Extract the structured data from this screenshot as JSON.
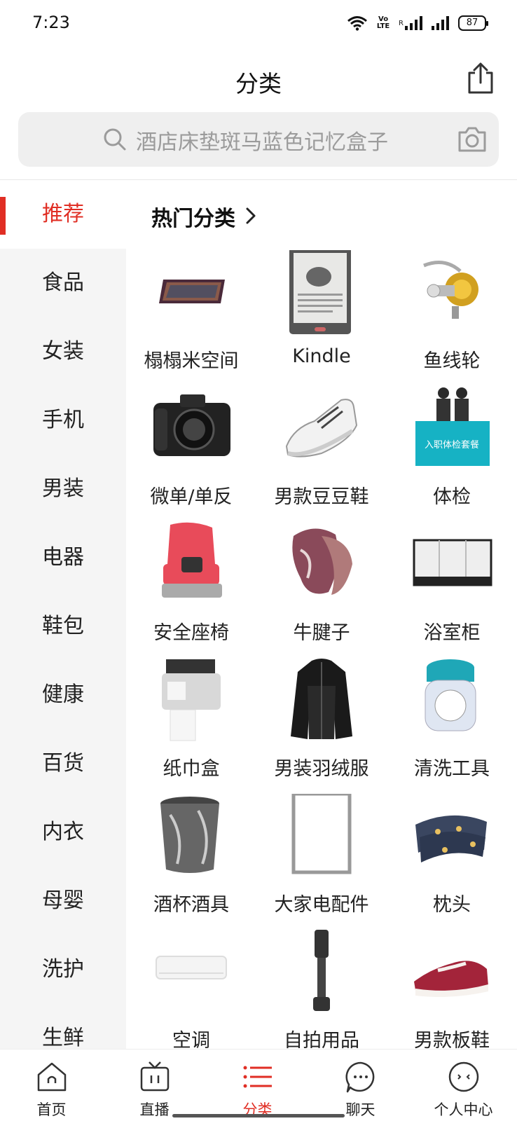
{
  "status": {
    "time": "7:23",
    "battery": "87",
    "volte_top": "Vo",
    "volte_bottom": "LTE",
    "sim_label": "R"
  },
  "header": {
    "title": "分类"
  },
  "search": {
    "placeholder": "酒店床垫斑马蓝色记忆盒子"
  },
  "sidebar": {
    "items": [
      {
        "label": "推荐",
        "active": true
      },
      {
        "label": "食品"
      },
      {
        "label": "女装"
      },
      {
        "label": "手机"
      },
      {
        "label": "男装"
      },
      {
        "label": "电器"
      },
      {
        "label": "鞋包"
      },
      {
        "label": "健康"
      },
      {
        "label": "百货"
      },
      {
        "label": "内衣"
      },
      {
        "label": "母婴"
      },
      {
        "label": "洗护"
      },
      {
        "label": "生鲜"
      }
    ]
  },
  "content": {
    "section_title": "热门分类",
    "categories": [
      {
        "label": "榻榻米空间",
        "icon": "tatami-rug-image"
      },
      {
        "label": "Kindle",
        "icon": "ereader-image"
      },
      {
        "label": "鱼线轮",
        "icon": "fishing-reel-image"
      },
      {
        "label": "微单/单反",
        "icon": "camera-image"
      },
      {
        "label": "男款豆豆鞋",
        "icon": "sneaker-image"
      },
      {
        "label": "体检",
        "icon": "health-checkup-image"
      },
      {
        "label": "安全座椅",
        "icon": "child-seat-image"
      },
      {
        "label": "牛腱子",
        "icon": "beef-shank-image"
      },
      {
        "label": "浴室柜",
        "icon": "bathroom-cabinet-image"
      },
      {
        "label": "纸巾盒",
        "icon": "tissue-box-image"
      },
      {
        "label": "男装羽绒服",
        "icon": "down-jacket-image"
      },
      {
        "label": "清洗工具",
        "icon": "lens-cleaner-image"
      },
      {
        "label": "酒杯酒具",
        "icon": "ice-bucket-image"
      },
      {
        "label": "大家电配件",
        "icon": "appliance-frame-image"
      },
      {
        "label": "枕头",
        "icon": "pillow-image"
      },
      {
        "label": "空调",
        "icon": "air-conditioner-image"
      },
      {
        "label": "自拍用品",
        "icon": "selfie-stick-image"
      },
      {
        "label": "男款板鞋",
        "icon": "board-shoe-image"
      }
    ],
    "promo_thumb": {
      "badge_text": "入职体检套餐"
    }
  },
  "tabbar": {
    "items": [
      {
        "label": "首页",
        "icon": "home-icon"
      },
      {
        "label": "直播",
        "icon": "tv-icon"
      },
      {
        "label": "分类",
        "icon": "category-list-icon",
        "active": true
      },
      {
        "label": "聊天",
        "icon": "chat-bubble-icon"
      },
      {
        "label": "个人中心",
        "icon": "profile-face-icon"
      }
    ]
  },
  "colors": {
    "accent": "#e02e24",
    "sidebar_bg": "#f5f5f5",
    "search_bg": "#efefef"
  }
}
